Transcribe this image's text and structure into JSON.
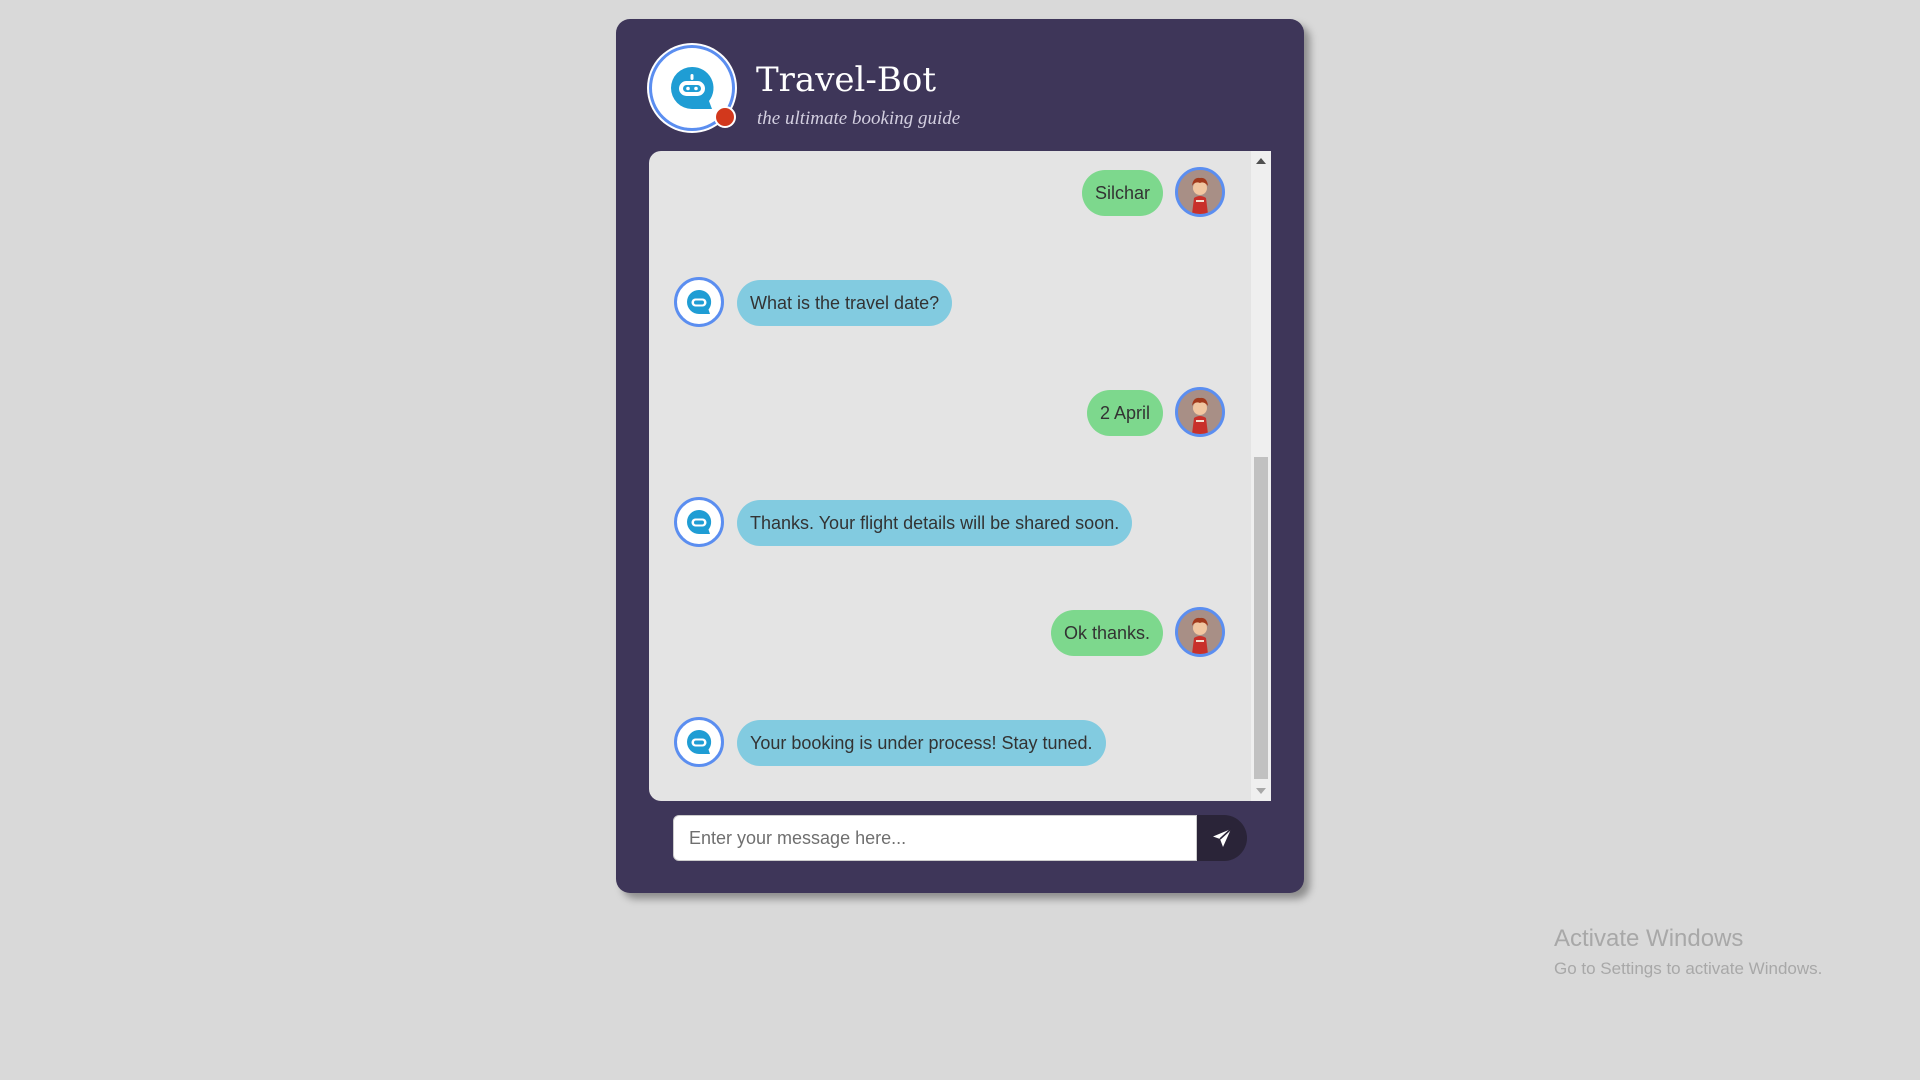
{
  "header": {
    "title": "Travel-Bot",
    "subtitle": "the ultimate booking guide"
  },
  "messages": [
    {
      "sender": "user",
      "text": "Silchar"
    },
    {
      "sender": "bot",
      "text": "What is the travel date?"
    },
    {
      "sender": "user",
      "text": "2 April"
    },
    {
      "sender": "bot",
      "text": "Thanks. Your flight details will be shared soon."
    },
    {
      "sender": "user",
      "text": "Ok thanks."
    },
    {
      "sender": "bot",
      "text": "Your booking is under process! Stay tuned."
    }
  ],
  "composer": {
    "placeholder": "Enter your message here...",
    "value": ""
  },
  "watermark": {
    "title": "Activate Windows",
    "subtitle": "Go to Settings to activate Windows."
  },
  "icons": {
    "bot": "robot-chat-icon",
    "user": "user-avatar",
    "send": "send-arrow-icon",
    "status": "status-dot"
  },
  "colors": {
    "window_bg": "#3e3659",
    "user_bubble": "#7dd88d",
    "bot_bubble": "#82cbe0",
    "avatar_ring": "#5b8ef0",
    "status_dot": "#d2381c",
    "send_button": "#2a2438"
  }
}
